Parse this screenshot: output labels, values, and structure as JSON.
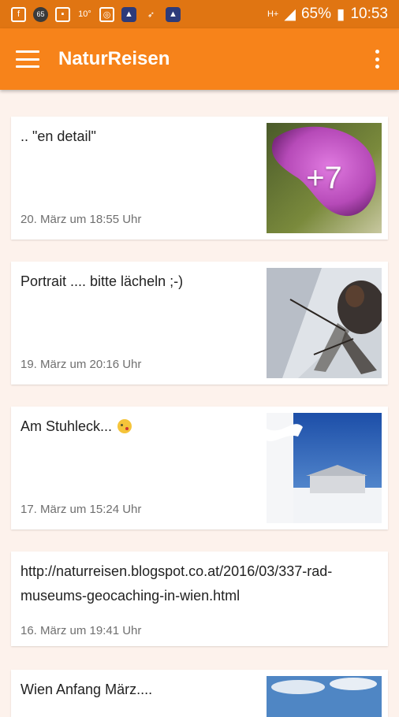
{
  "statusbar": {
    "icons": [
      "facebook-icon",
      "badge-icon",
      "gallery-icon",
      "temperature-icon",
      "instagram-icon",
      "app-icon",
      "running-icon",
      "app-icon"
    ],
    "badge": "65",
    "temperature": "10°",
    "network": "H+",
    "battery": "65%",
    "time": "10:53"
  },
  "appbar": {
    "title": "NaturReisen",
    "color": "#f7831a"
  },
  "posts": [
    {
      "text": ".. \"en detail\"",
      "date": "20. März um 18:55 Uhr",
      "more": "+7",
      "thumb": "flower"
    },
    {
      "text": "Portrait .... bitte lächeln ;-)",
      "date": "19. März um 20:16 Uhr",
      "thumb": "fly"
    },
    {
      "text": "Am Stuhleck... ",
      "emoji": "kissing-face-emoji",
      "date": "17. März um 15:24 Uhr",
      "thumb": "snow"
    },
    {
      "text": "http://naturreisen.blogspot.co.at/2016/03/337-rad-museums-geocaching-in-wien.html",
      "date": "16. März um 19:41 Uhr"
    },
    {
      "text": "Wien Anfang März....",
      "thumb": "sky"
    }
  ]
}
